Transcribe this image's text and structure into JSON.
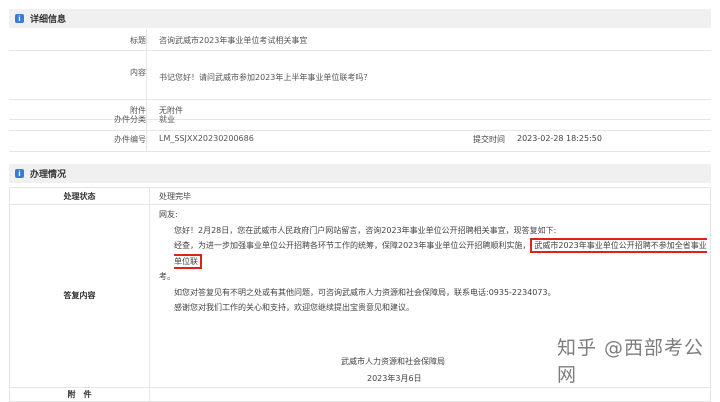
{
  "detail": {
    "header": "详细信息",
    "title_label": "标题",
    "title_value": "咨询武威市2023年事业单位考试相关事宜",
    "content_label": "内容",
    "content_value": "书记您好！请问武威市参加2023年上半年事业单位联考吗？",
    "attach_label": "附件",
    "attach_value": "无附件",
    "category_label": "办件分类",
    "category_value": "就业",
    "number_label": "办件编号",
    "number_value": "LM_SSJXX20230200686",
    "submit_label": "提交时间",
    "submit_value": "2023-02-28 18:25:50"
  },
  "handling": {
    "header": "办理情况",
    "status_label": "处理状态",
    "status_value": "处理完毕",
    "reply_label": "答复内容",
    "greeting": "网友:",
    "para1": "您好！2月28日，您在武威市人民政府门户网站留言，咨询2023年事业单位公开招聘相关事宜，现答复如下:",
    "para2a": "经查，为进一步加强事业单位公开招聘各环节工作的统筹，保障2023年事业单位公开招聘顺利实施，",
    "para2b": "武威市2023年事业单位公开招聘不参加全省事业单位联",
    "para2c": "考。",
    "para3": "如您对答复见有不明之处或有其他问题，可咨询武威市人力资源和社会保障局，联系电话:0935-2234073。",
    "para4": "感谢您对我们工作的关心和支持，欢迎您继续提出宝贵意见和建议。",
    "signature_org": "武威市人力资源和社会保障局",
    "signature_date": "2023年3月6日",
    "attach_label": "附　件"
  },
  "watermark": "知乎 @西部考公网"
}
